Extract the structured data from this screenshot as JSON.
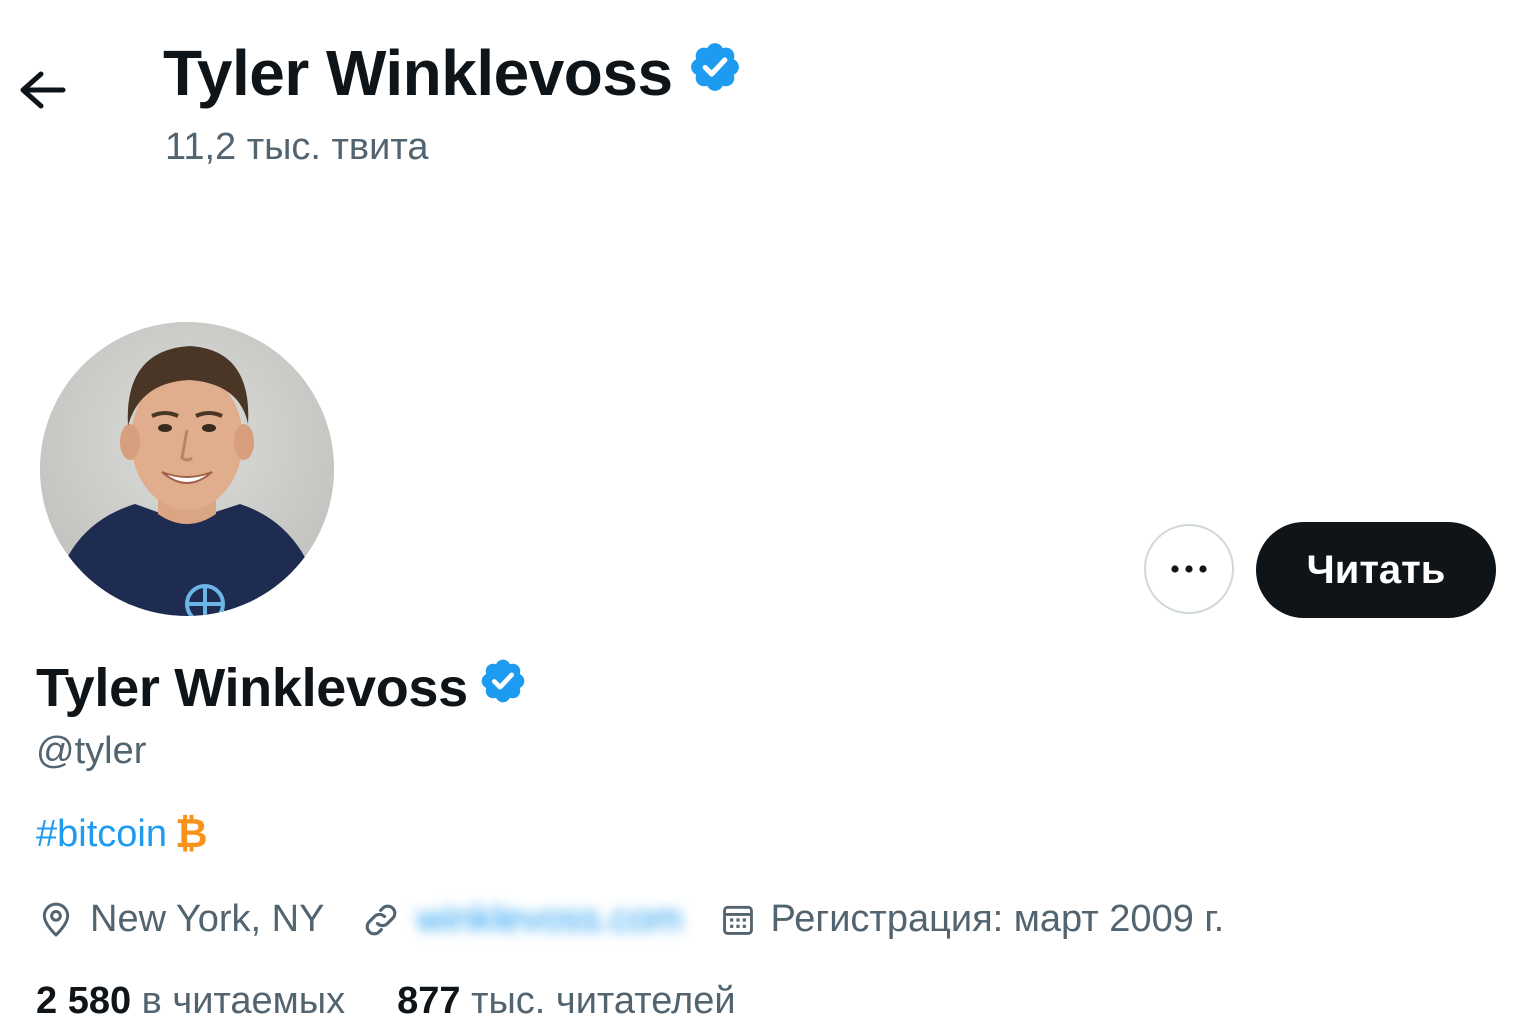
{
  "header": {
    "title": "Tyler Winklevoss",
    "tweet_count": "11,2 тыс. твита"
  },
  "profile": {
    "name": "Tyler Winklevoss",
    "handle": "@tyler",
    "bio_hashtag": "#bitcoin",
    "bio_symbol": "₿",
    "location": "New York, NY",
    "website": "winklevoss.com",
    "joined": "Регистрация: март 2009 г."
  },
  "actions": {
    "more_label": "···",
    "follow_label": "Читать"
  },
  "stats": {
    "following_count": "2 580",
    "following_label": "в читаемых",
    "followers_count": "877",
    "followers_label": "тыс. читателей"
  },
  "colors": {
    "accent": "#1d9bf0",
    "text": "#0f1419",
    "secondary": "#536471",
    "bitcoin": "#f7931a"
  },
  "icons": {
    "back": "arrow-left-icon",
    "verified": "verified-badge-icon",
    "location": "location-pin-icon",
    "link": "link-icon",
    "calendar": "calendar-icon",
    "more": "more-icon"
  }
}
